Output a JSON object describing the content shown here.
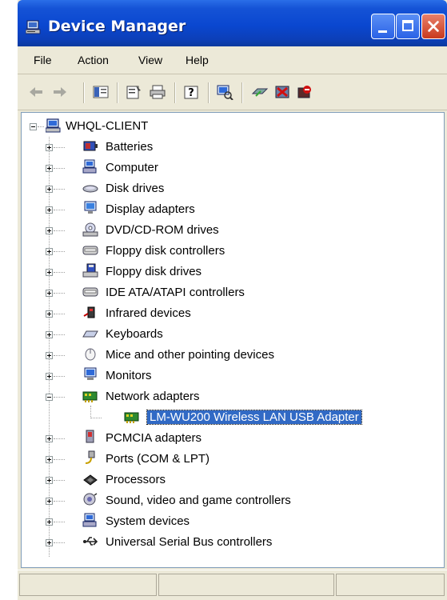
{
  "window": {
    "title": "Device Manager"
  },
  "menu": [
    "File",
    "Action",
    "View",
    "Help"
  ],
  "toolbar": [
    "back-arrow-icon",
    "forward-arrow-icon",
    "show-hide-tree-icon",
    "properties-icon",
    "print-icon",
    "help-icon",
    "scan-hardware-icon",
    "update-driver-icon",
    "uninstall-icon",
    "disable-icon"
  ],
  "tree": {
    "root": "WHQL-CLIENT",
    "categories": [
      "Batteries",
      "Computer",
      "Disk drives",
      "Display adapters",
      "DVD/CD-ROM drives",
      "Floppy disk controllers",
      "Floppy disk drives",
      "IDE ATA/ATAPI controllers",
      "Infrared devices",
      "Keyboards",
      "Mice and other pointing devices",
      "Monitors",
      "Network adapters",
      "PCMCIA adapters",
      "Ports (COM & LPT)",
      "Processors",
      "Sound, video and game controllers",
      "System devices",
      "Universal Serial Bus controllers"
    ],
    "network_child": "LM-WU200 Wireless LAN USB Adapter"
  },
  "colors": {
    "title_bar": "#0A47D0",
    "selection": "#316AC5",
    "chrome": "#ECE9D8"
  }
}
